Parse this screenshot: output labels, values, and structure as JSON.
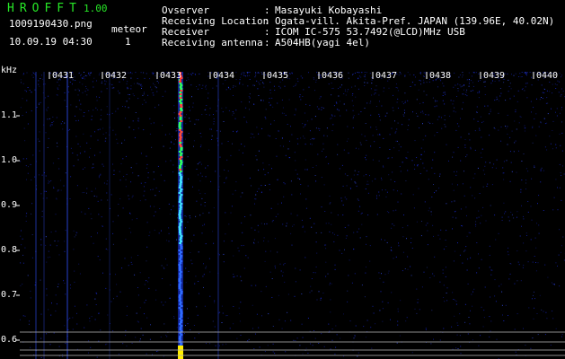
{
  "header": {
    "brand": "HROFFT",
    "version": "1.00",
    "filename": "1009190430.png",
    "datetime": "10.09.19 04:30",
    "counter_label": "meteor",
    "counter_value": "1"
  },
  "info": [
    {
      "label": "Ovserver",
      "value": "Masayuki Kobayashi"
    },
    {
      "label": "Receiving Location",
      "value": "Ogata-vill. Akita-Pref. JAPAN (139.96E, 40.02N)"
    },
    {
      "label": "Receiver",
      "value": "ICOM IC-575 53.7492(@LCD)MHz USB"
    },
    {
      "label": "Receiving antenna",
      "value": "A504HB(yagi 4el)"
    }
  ],
  "axis": {
    "unit": "kHz",
    "y_ticks": [
      "1.1",
      "1.0",
      "0.9",
      "0.8",
      "0.7",
      "0.6"
    ],
    "x_ticks": [
      "0431",
      "0432",
      "0433",
      "0434",
      "0435",
      "0436",
      "0437",
      "0438",
      "0439",
      "0440"
    ]
  },
  "colors": {
    "background": "#000000",
    "brand": "#27e827",
    "text": "#ffffff",
    "noise": "#1a2bd8",
    "marker": "#ff3030",
    "echo": "#ffee00"
  }
}
